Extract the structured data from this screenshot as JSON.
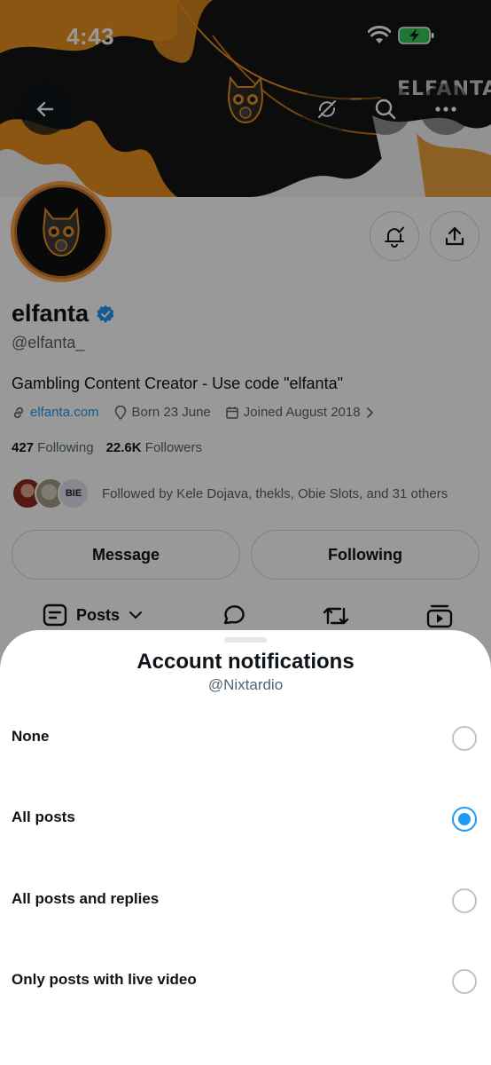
{
  "status_bar": {
    "time": "4:43"
  },
  "banner": {
    "brand_text": "ELFANTA"
  },
  "profile": {
    "display_name": "elfanta",
    "handle": "@elfanta_",
    "bio": "Gambling Content Creator - Use code \"elfanta\"",
    "website": "elfanta.com",
    "born": "Born 23 June",
    "joined": "Joined August 2018",
    "following_count": "427",
    "following_label": "Following",
    "followers_count": "22.6K",
    "followers_label": "Followers",
    "followed_by": "Followed by Kele Dojava, thekls, Obie Slots, and 31 others",
    "follower_avatar_3_text": "BIE"
  },
  "actions": {
    "message_label": "Message",
    "following_label": "Following"
  },
  "tabs": {
    "posts_label": "Posts"
  },
  "sheet": {
    "title": "Account notifications",
    "subtitle": "@Nixtardio",
    "options": [
      {
        "label": "None",
        "selected": false
      },
      {
        "label": "All posts",
        "selected": true
      },
      {
        "label": "All posts and replies",
        "selected": false
      },
      {
        "label": "Only posts with live video",
        "selected": false
      }
    ]
  },
  "colors": {
    "accent": "#1d9bf0",
    "banner_orange": "#e8901f",
    "banner_dark": "#151515",
    "verified": "#1d9bf0"
  }
}
